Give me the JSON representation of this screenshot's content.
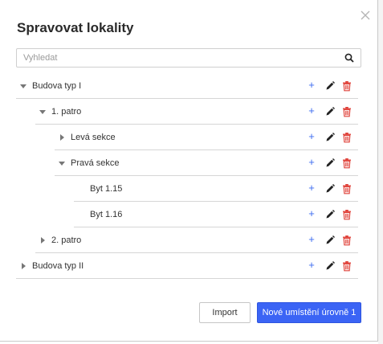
{
  "dialog": {
    "title": "Spravovat lokality",
    "close_icon": "close-icon"
  },
  "search": {
    "placeholder": "Vyhledat",
    "value": "",
    "icon": "search-icon"
  },
  "tree": {
    "rows": [
      {
        "label": "Budova typ I",
        "level": 0,
        "expanded": true,
        "has_children": true
      },
      {
        "label": "1. patro",
        "level": 1,
        "expanded": true,
        "has_children": true
      },
      {
        "label": "Levá sekce",
        "level": 2,
        "expanded": false,
        "has_children": true
      },
      {
        "label": "Pravá sekce",
        "level": 2,
        "expanded": true,
        "has_children": true
      },
      {
        "label": "Byt 1.15",
        "level": 3,
        "expanded": false,
        "has_children": false
      },
      {
        "label": "Byt 1.16",
        "level": 3,
        "expanded": false,
        "has_children": false
      },
      {
        "label": "2. patro",
        "level": 1,
        "expanded": false,
        "has_children": true
      },
      {
        "label": "Budova typ II",
        "level": 0,
        "expanded": false,
        "has_children": true
      }
    ],
    "actions": {
      "add_symbol": "+",
      "add_icon": "plus-icon",
      "edit_icon": "pencil-icon",
      "delete_icon": "trash-icon"
    }
  },
  "colors": {
    "accent": "#3b64f5",
    "add": "#3d6cf0",
    "delete": "#e0433b",
    "edit": "#222222"
  },
  "footer": {
    "import_label": "Import",
    "new_label": "Nové umístění úrovně 1"
  }
}
